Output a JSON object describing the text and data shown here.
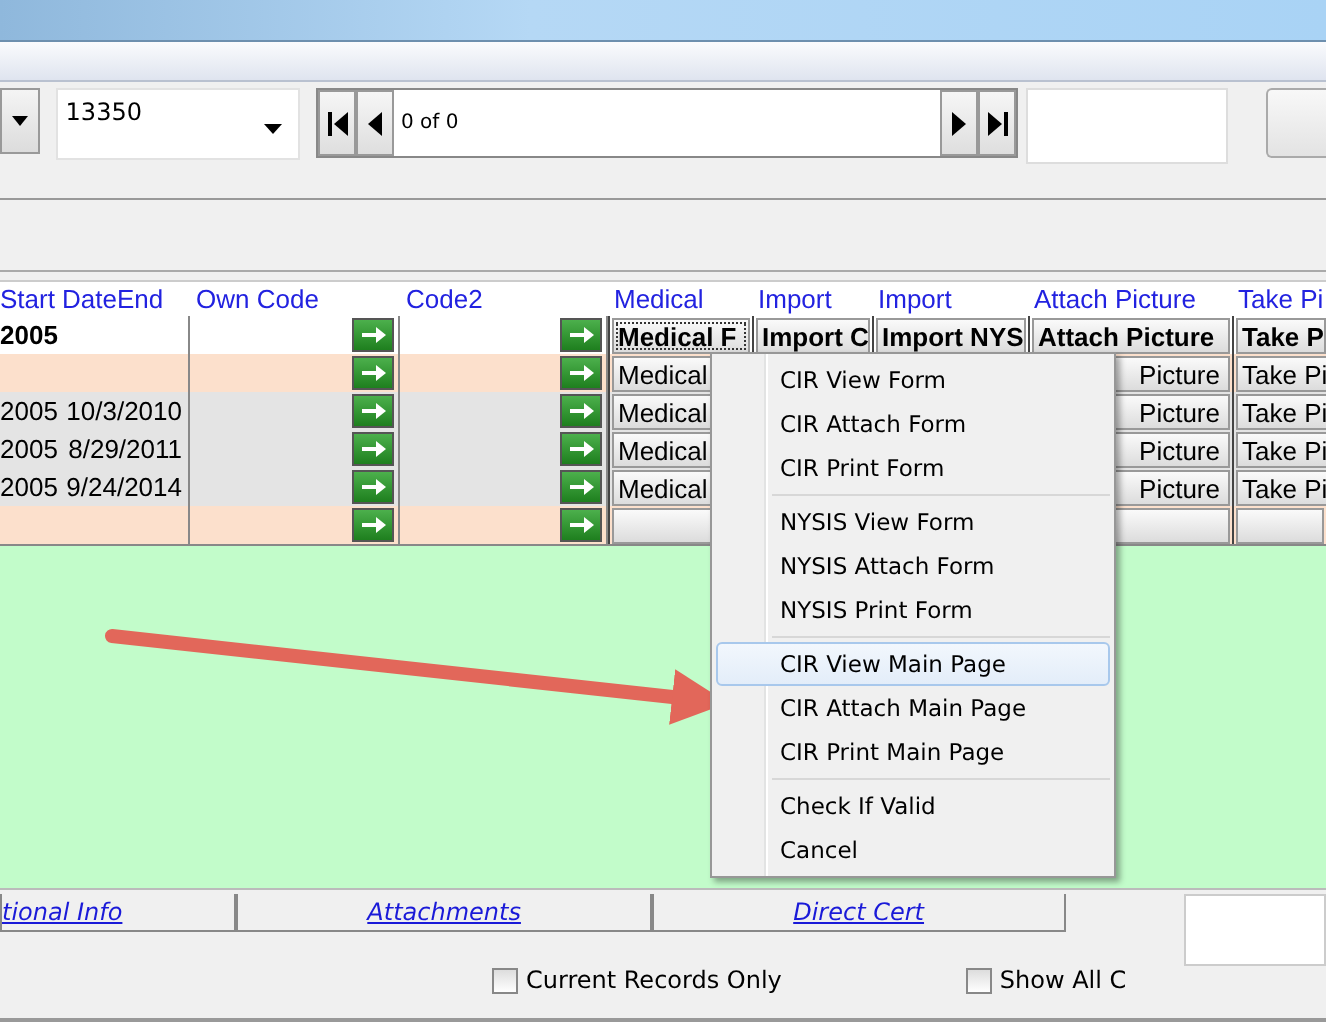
{
  "toolbar": {
    "combo_value": "13350",
    "navigator": {
      "position": "0 of 0"
    }
  },
  "grid": {
    "columns": [
      {
        "label": "Start",
        "kind": "text"
      },
      {
        "label": "DateEnd",
        "kind": "text"
      },
      {
        "label": "Own Code",
        "kind": "code"
      },
      {
        "label": "Code2",
        "kind": "code"
      },
      {
        "label": "Medical",
        "kind": "button"
      },
      {
        "label": "Import",
        "kind": "button"
      },
      {
        "label": "Import",
        "kind": "button"
      },
      {
        "label": "Attach Picture",
        "kind": "button"
      },
      {
        "label": "Take Pi",
        "kind": "button"
      }
    ],
    "rows": [
      {
        "selected": true,
        "color": "#ffffff",
        "cells": [
          "2005",
          "",
          "",
          "",
          "Medical F",
          "Import C",
          "Import NYS",
          "Attach Picture",
          "Take P"
        ]
      },
      {
        "selected": false,
        "color": "#fce0cc",
        "cells": [
          "",
          "",
          "",
          "",
          "Medical",
          null,
          null,
          "Picture",
          "Take Pi"
        ]
      },
      {
        "selected": false,
        "color": "#e4e4e4",
        "cells": [
          "2005",
          "10/3/2010",
          "",
          "",
          "Medical",
          null,
          null,
          "Picture",
          "Take Pi"
        ]
      },
      {
        "selected": false,
        "color": "#e4e4e4",
        "cells": [
          "2005",
          "8/29/2011",
          "",
          "",
          "Medical",
          null,
          null,
          "Picture",
          "Take Pi"
        ]
      },
      {
        "selected": false,
        "color": "#e4e4e4",
        "cells": [
          "2005",
          "9/24/2014",
          "",
          "",
          "Medical",
          null,
          null,
          "Picture",
          "Take Pi"
        ]
      },
      {
        "selected": false,
        "color": "#fce0cc",
        "cells": [
          "",
          "",
          "",
          "",
          "",
          null,
          null,
          "",
          ""
        ]
      }
    ]
  },
  "context_menu": {
    "groups": [
      [
        {
          "label": "CIR View Form",
          "selected": false
        },
        {
          "label": "CIR Attach Form",
          "selected": false
        },
        {
          "label": "CIR Print Form",
          "selected": false
        }
      ],
      [
        {
          "label": "NYSIS View Form",
          "selected": false
        },
        {
          "label": "NYSIS Attach Form",
          "selected": false
        },
        {
          "label": "NYSIS Print Form",
          "selected": false
        }
      ],
      [
        {
          "label": "CIR View Main Page",
          "selected": true
        },
        {
          "label": "CIR Attach Main Page",
          "selected": false
        },
        {
          "label": "CIR Print Main Page",
          "selected": false
        }
      ],
      [
        {
          "label": "Check If Valid",
          "selected": false
        },
        {
          "label": "Cancel",
          "selected": false
        }
      ]
    ]
  },
  "tabs": [
    {
      "label": "tional Info"
    },
    {
      "label": "Attachments"
    },
    {
      "label": "Direct Cert"
    }
  ],
  "filters": [
    {
      "label": "Current Records Only",
      "checked": false
    },
    {
      "label": "Show All C",
      "checked": false
    }
  ]
}
